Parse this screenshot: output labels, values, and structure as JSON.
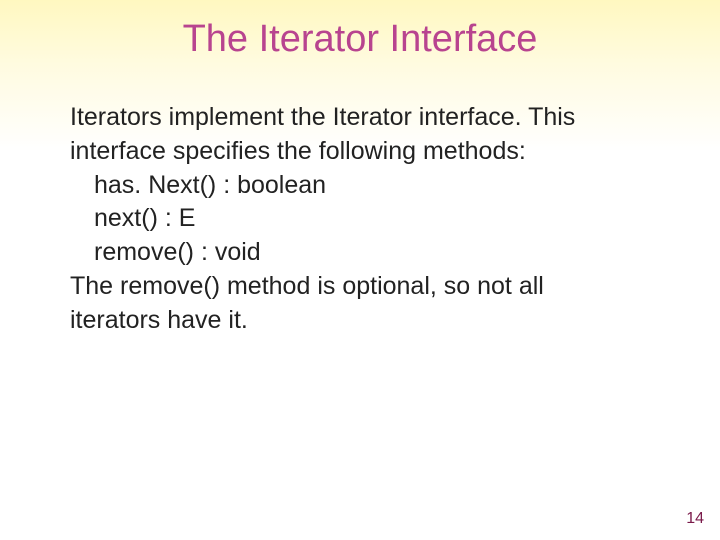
{
  "title": "The Iterator Interface",
  "paragraph_intro_1": "Iterators implement the Iterator interface. This",
  "paragraph_intro_2": "interface specifies the following methods:",
  "method_1": "has. Next() : boolean",
  "method_2": "next() : E",
  "method_3": "remove() : void",
  "paragraph_outro_1": "The remove() method is optional, so not all",
  "paragraph_outro_2": "iterators have it.",
  "page_number": "14"
}
